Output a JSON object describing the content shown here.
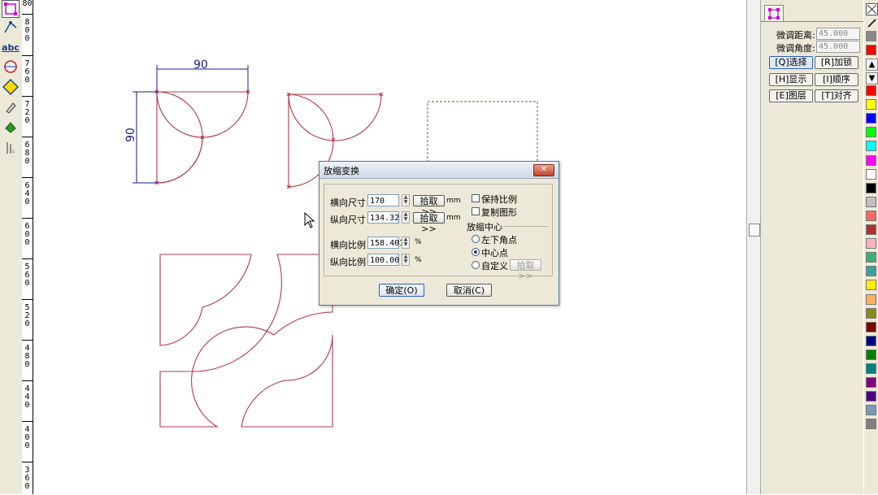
{
  "left_toolbar": {
    "icons": [
      "node-edit-icon",
      "bezier-tool-icon",
      "text-tool-icon",
      "circle-tool-icon",
      "diamond-tool-icon",
      "eraser-icon",
      "fill-tool-icon",
      "measure-tool-icon"
    ],
    "text_tool_label": "abc"
  },
  "ruler": {
    "labels": [
      "80",
      "800",
      "760",
      "720",
      "680",
      "640",
      "600",
      "560",
      "520",
      "480",
      "440",
      "400",
      "360"
    ]
  },
  "canvas": {
    "dimension_horizontal": "90",
    "dimension_vertical": "90"
  },
  "dialog": {
    "title": "放缩变换",
    "close_label": "✕",
    "width_label": "横向尺寸",
    "width_value": "170",
    "height_label": "纵向尺寸",
    "height_value": "134.32",
    "pick_label": "拾取>>",
    "size_unit": "mm",
    "hscale_label": "横向比例",
    "hscale_value": "158.401",
    "vscale_label": "纵向比例",
    "vscale_value": "100.00",
    "percent_unit": "%",
    "keep_ratio_label": "保持比例",
    "keep_ratio_checked": false,
    "copy_shape_label": "复制图形",
    "copy_shape_checked": false,
    "center_group_label": "放缩中心",
    "center_options": [
      "左下角点",
      "中心点",
      "自定义"
    ],
    "center_selected": "中心点",
    "custom_pick_label": "拾取>>",
    "ok_label": "确定(O)",
    "cancel_label": "取消(C)"
  },
  "right_panel": {
    "tab_icon": "node-select-icon",
    "fine_distance_label": "微调距离:",
    "fine_distance_value": "45.000",
    "fine_angle_label": "微调角度:",
    "fine_angle_value": "45.000",
    "buttons": [
      "[Q]选择",
      "[R]加锁",
      "[H]显示",
      "[I]顺序",
      "[E]图层",
      "[T]对齐"
    ],
    "selected_button": "[Q]选择"
  },
  "palette": {
    "colors": [
      "#ff0000",
      "#ff0000",
      "#ffff00",
      "#0000ff",
      "#00ff00",
      "#00ffff",
      "#ff00ff",
      "#ffffff",
      "#000000",
      "#c0c0c0",
      "#ff6666",
      "#b03030",
      "#ffb0c0",
      "#40b070",
      "#40a0a0",
      "#ffee00",
      "#ffb060",
      "#8a8a20",
      "#800000",
      "#000080",
      "#008000",
      "#008080",
      "#800080",
      "#4b0082",
      "#7a9ab8",
      "#808080"
    ]
  },
  "colors": {
    "shape_stroke": "#b03a48",
    "dimension_stroke": "#1a1a8a",
    "selection_box": "#6b6b1a",
    "panel_bg": "#ece9d8"
  }
}
